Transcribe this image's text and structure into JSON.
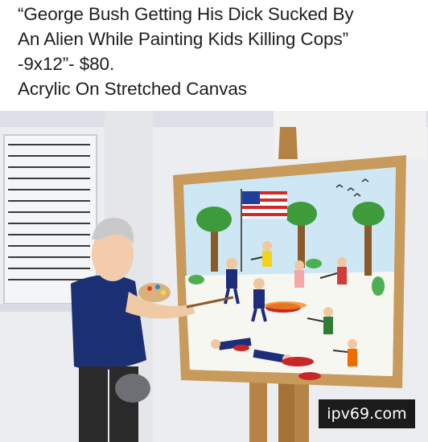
{
  "post": {
    "caption_lines": [
      "“George Bush Getting His Dick Sucked By",
      "An Alien While Painting Kids Killing Cops”",
      "-9x12”- $80.",
      "Acrylic On Stretched Canvas"
    ]
  },
  "image": {
    "description_icon": "painting-image",
    "colors": {
      "wall": "#e9ebee",
      "easel": "#c79a5e",
      "canvas_sky": "#c9e6f3",
      "tree_leaves": "#3a9a3a",
      "shirt": "#1b2f73"
    }
  },
  "watermark": {
    "text": "ipv69.com"
  }
}
